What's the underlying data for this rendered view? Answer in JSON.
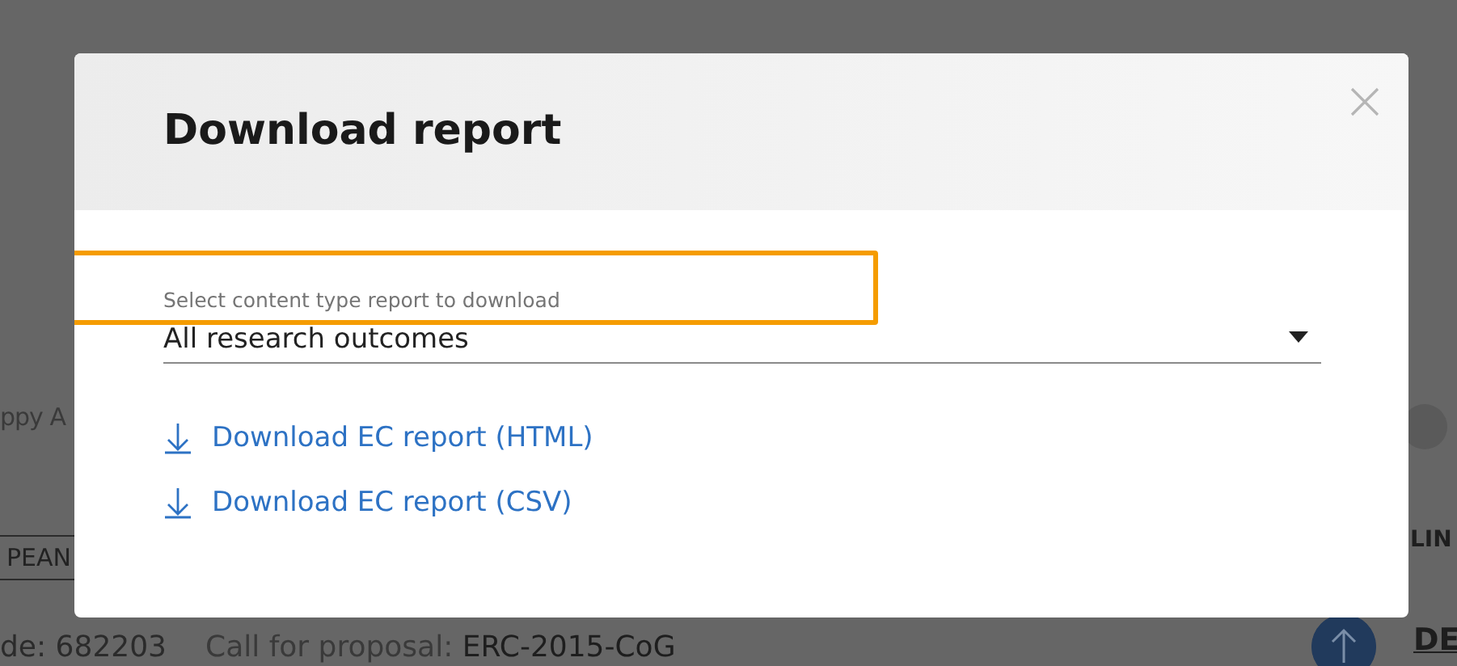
{
  "background_page": {
    "left_text": "ppy A",
    "tab_label": "PEAN",
    "project_code": "de: 682203",
    "call_label": "Call for proposal:",
    "call_value": "ERC-2015-CoG",
    "section_heading": "LIN",
    "link_text": "DE"
  },
  "dialog": {
    "title": "Download report",
    "select": {
      "label": "Select content type report to download",
      "value": "All research outcomes"
    },
    "links": [
      {
        "label": "Download EC report (HTML)"
      },
      {
        "label": "Download EC report (CSV)"
      }
    ]
  }
}
